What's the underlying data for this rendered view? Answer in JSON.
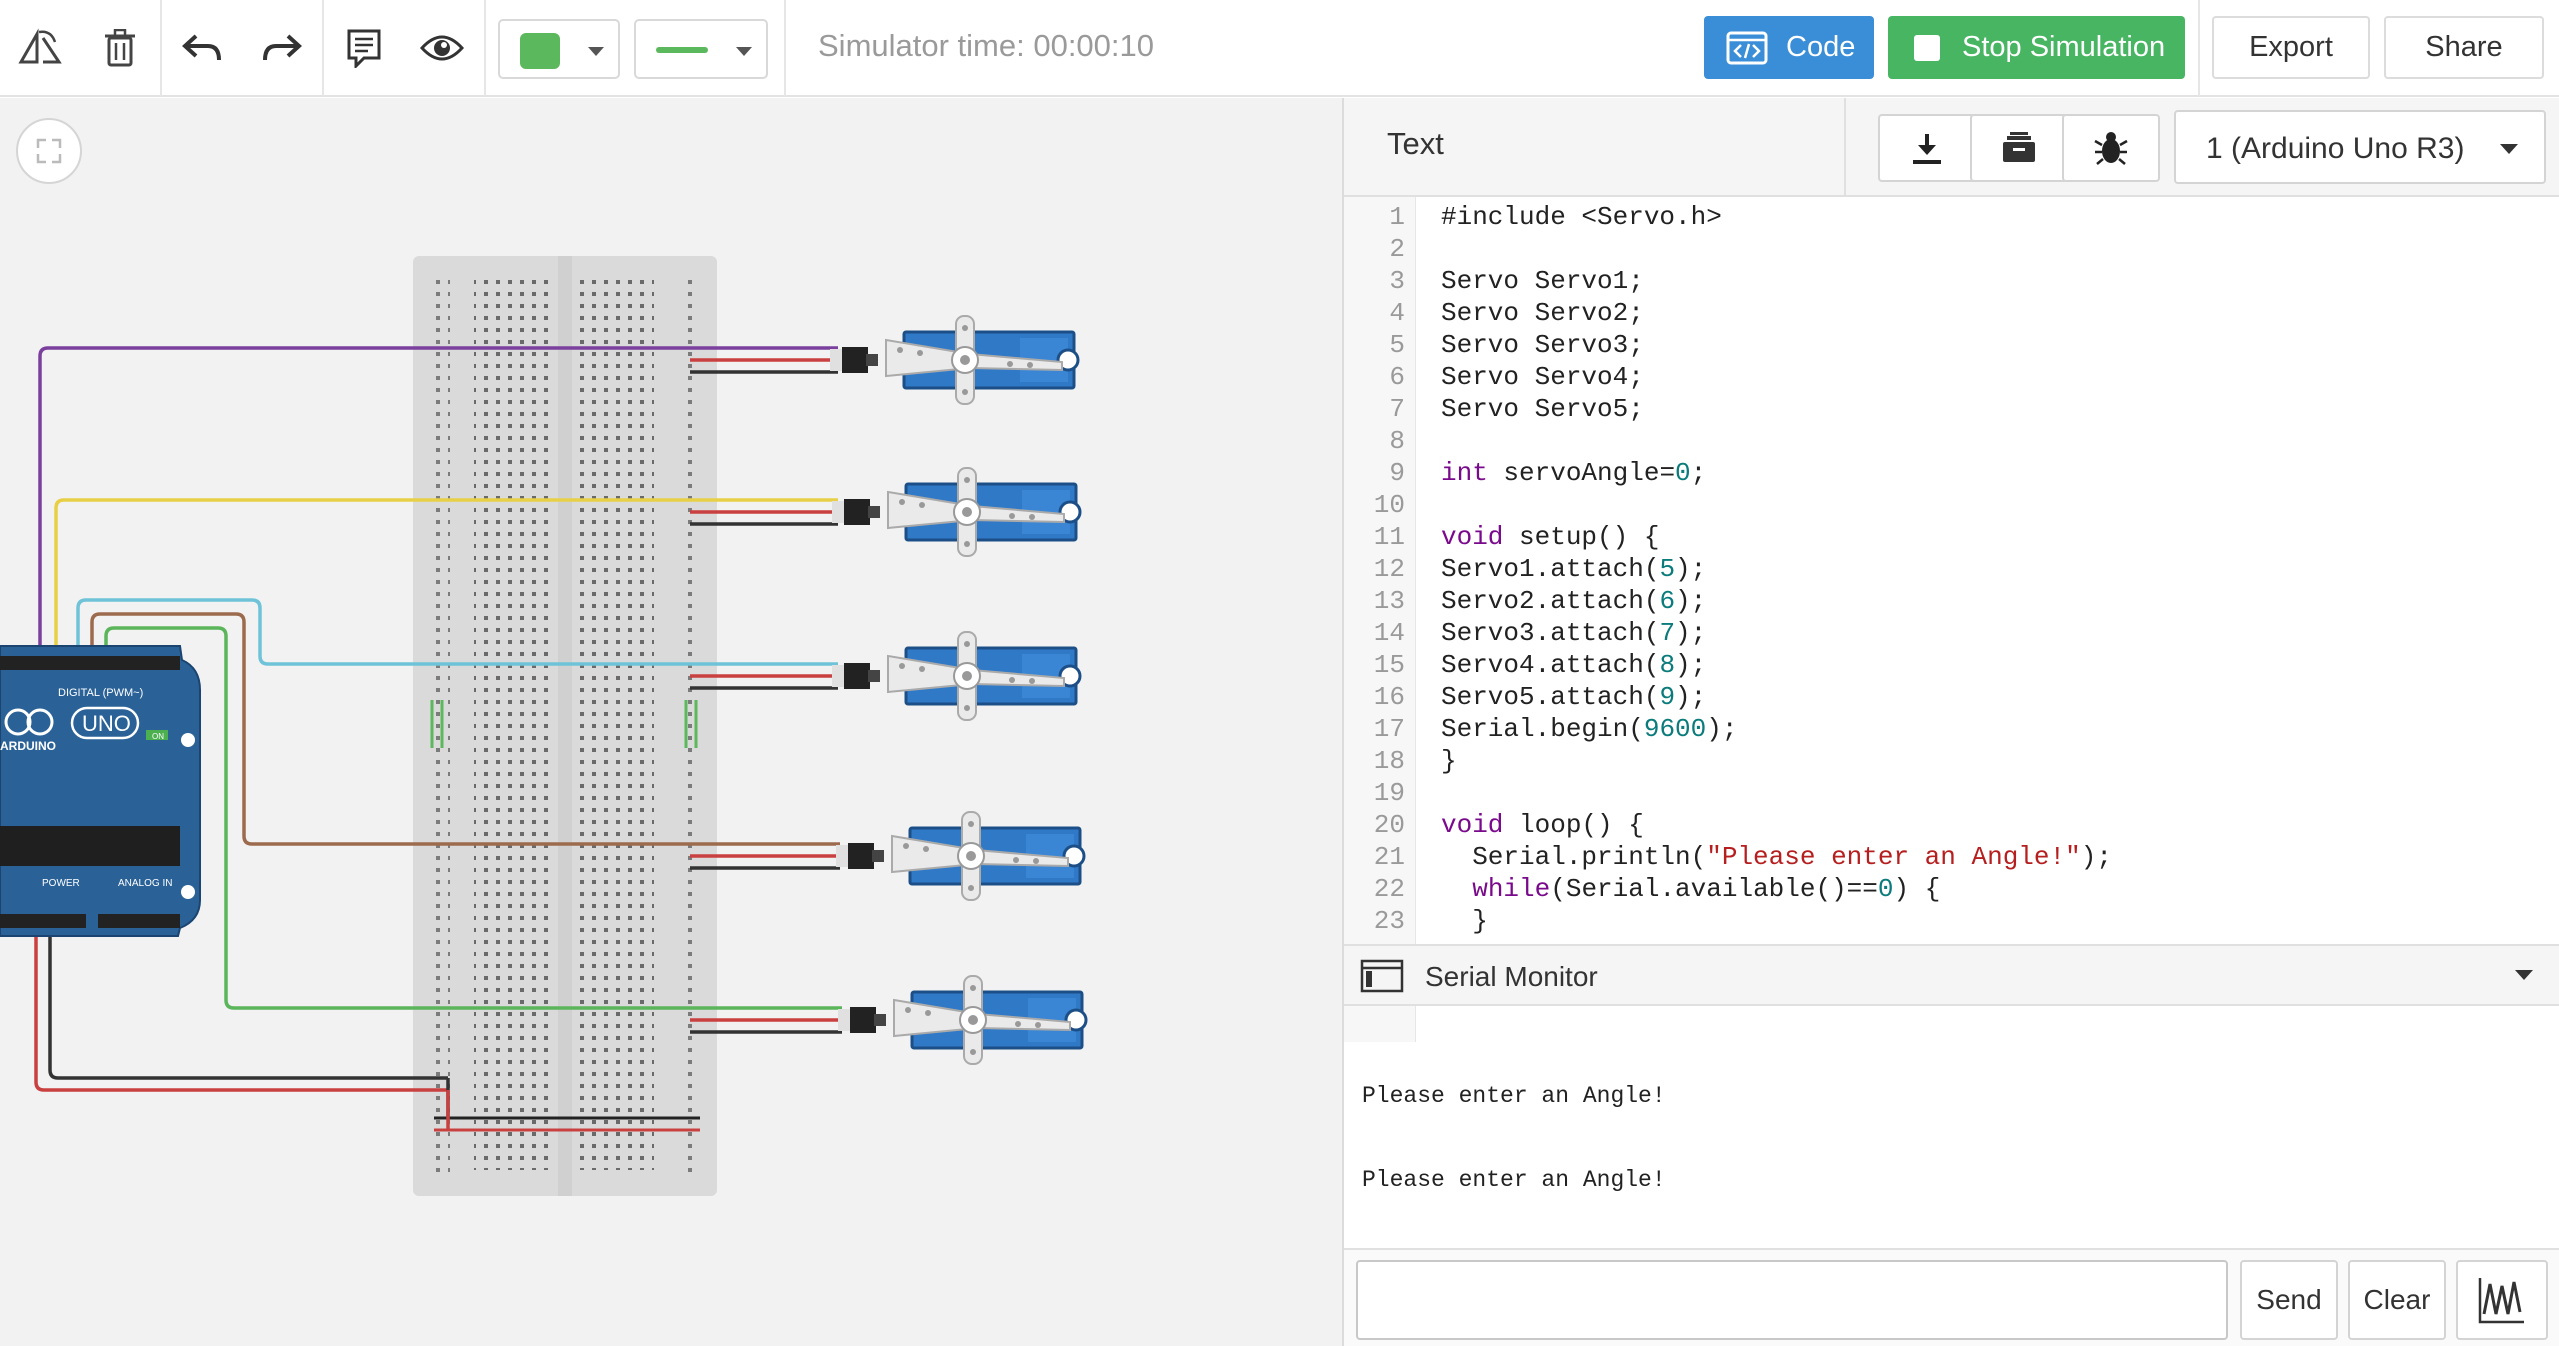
{
  "toolbar": {
    "icons": [
      "rotate-icon",
      "trash-icon",
      "undo-icon",
      "redo-icon",
      "notes-icon",
      "eye-icon"
    ],
    "color_swatch": "#5cb85c",
    "wire_swatch": "#5cb85c",
    "sim_time": "Simulator time: 00:00:10",
    "code_label": "Code",
    "stop_label": "Stop Simulation",
    "export_label": "Export",
    "share_label": "Share"
  },
  "editor": {
    "mode": "Text",
    "board": "1 (Arduino Uno R3)",
    "lines": [
      {
        "n": "1",
        "t": "#include <Servo.h>"
      },
      {
        "n": "2",
        "t": ""
      },
      {
        "n": "3",
        "t": "Servo Servo1;"
      },
      {
        "n": "4",
        "t": "Servo Servo2;"
      },
      {
        "n": "5",
        "t": "Servo Servo3;"
      },
      {
        "n": "6",
        "t": "Servo Servo4;"
      },
      {
        "n": "7",
        "t": "Servo Servo5;"
      },
      {
        "n": "8",
        "t": ""
      },
      {
        "n": "9",
        "t": "int servoAngle=0;"
      },
      {
        "n": "10",
        "t": ""
      },
      {
        "n": "11",
        "t": "void setup() {"
      },
      {
        "n": "12",
        "t": "Servo1.attach(5);"
      },
      {
        "n": "13",
        "t": "Servo2.attach(6);"
      },
      {
        "n": "14",
        "t": "Servo3.attach(7);"
      },
      {
        "n": "15",
        "t": "Servo4.attach(8);"
      },
      {
        "n": "16",
        "t": "Servo5.attach(9);"
      },
      {
        "n": "17",
        "t": "Serial.begin(9600);"
      },
      {
        "n": "18",
        "t": "}"
      },
      {
        "n": "19",
        "t": ""
      },
      {
        "n": "20",
        "t": "void loop() {"
      },
      {
        "n": "21",
        "t": "  Serial.println(\"Please enter an Angle!\");"
      },
      {
        "n": "22",
        "t": "  while(Serial.available()==0) {"
      },
      {
        "n": "23",
        "t": "  }"
      }
    ]
  },
  "serial": {
    "title": "Serial Monitor",
    "output": [
      "Please enter an Angle!",
      "Please enter an Angle!"
    ],
    "input_value": "",
    "send_label": "Send",
    "clear_label": "Clear"
  },
  "arduino": {
    "header_label": "DIGITAL (PWM~)",
    "logo": "ARDUINO",
    "model": "UNO",
    "on_label": "ON",
    "power_label": "POWER",
    "analog_label": "ANALOG IN"
  },
  "colors": {
    "code_button": "#3a8ed8",
    "stop_button": "#48b563",
    "servo_body": "#2f79c7",
    "board_blue": "#2a6298",
    "wires": [
      "#7b3f9e",
      "#e8cf46",
      "#6fc3d8",
      "#9c6b4e",
      "#5bb55a"
    ]
  }
}
